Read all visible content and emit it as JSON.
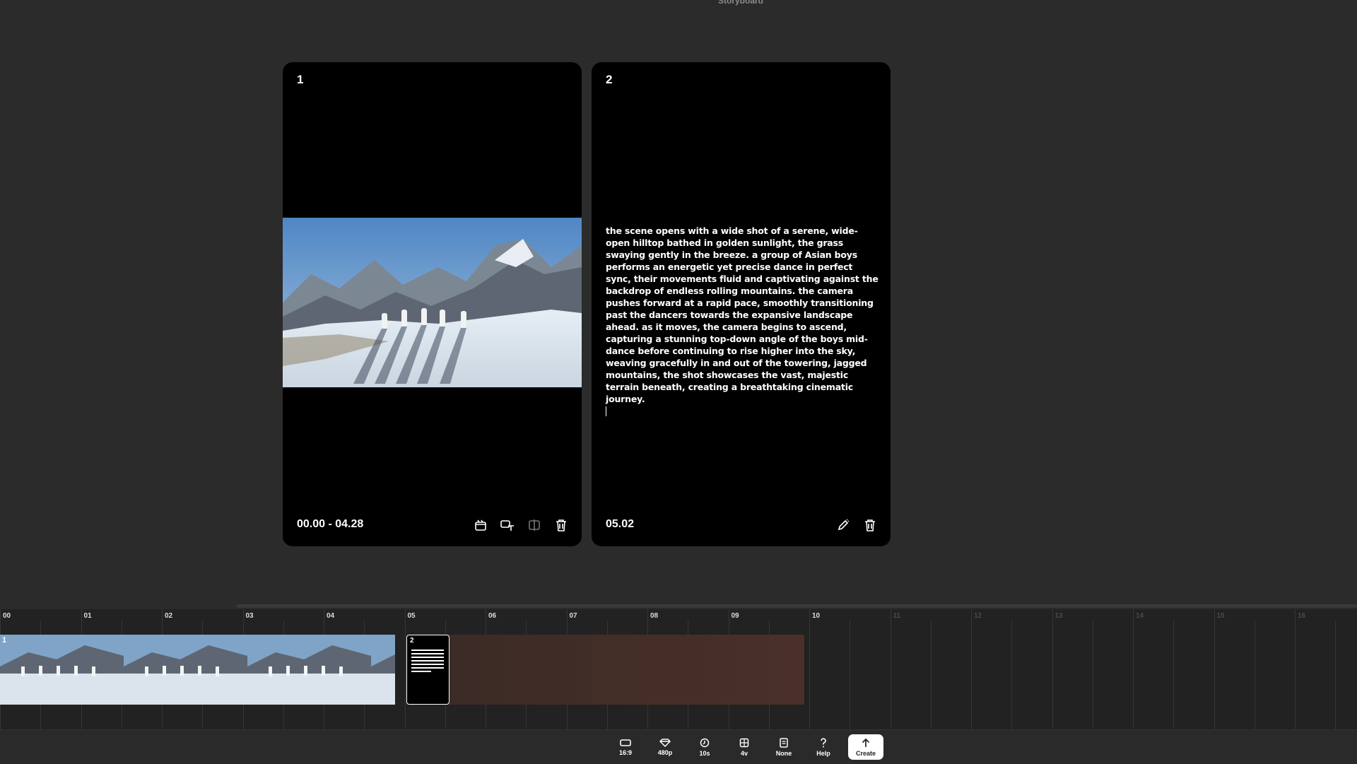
{
  "header": {
    "title": "Storyboard"
  },
  "cards": [
    {
      "number": "1",
      "time": "00.00 - 04.28",
      "actions": [
        "clapper-icon",
        "text-to-video-icon",
        "compare-icon",
        "trash-icon"
      ]
    },
    {
      "number": "2",
      "time": "05.02",
      "text": "the scene opens with a wide shot of a serene, wide-open hilltop bathed in golden sunlight, the grass swaying gently in the breeze. a group of Asian boys performs an energetic yet precise dance in perfect sync, their movements fluid and captivating against the backdrop of endless rolling mountains. the camera pushes forward at a rapid pace, smoothly transitioning past the dancers towards the expansive landscape ahead. as it moves, the camera begins to ascend, capturing a stunning top-down angle of the boys mid-dance before continuing to rise higher into the sky, weaving gracefully in and out of the towering, jagged mountains, the shot showcases the vast, majestic terrain beneath, creating a breathtaking cinematic journey.",
      "actions": [
        "edit-icon",
        "trash-icon"
      ]
    }
  ],
  "timeline": {
    "ticks": [
      "00",
      "01",
      "02",
      "03",
      "04",
      "05",
      "06",
      "07",
      "08",
      "09",
      "10",
      "11",
      "12",
      "13",
      "14",
      "15",
      "16"
    ],
    "clips": [
      {
        "number": "1"
      },
      {
        "number": "2"
      }
    ]
  },
  "toolbar": {
    "items": [
      {
        "label": "16:9",
        "icon": "aspect-ratio-icon"
      },
      {
        "label": "480p",
        "icon": "diamond-icon"
      },
      {
        "label": "10s",
        "icon": "clock-icon"
      },
      {
        "label": "4v",
        "icon": "grid-icon"
      },
      {
        "label": "None",
        "icon": "document-icon"
      },
      {
        "label": "Help",
        "icon": "help-icon"
      },
      {
        "label": "Create",
        "icon": "upload-arrow-icon"
      }
    ]
  }
}
